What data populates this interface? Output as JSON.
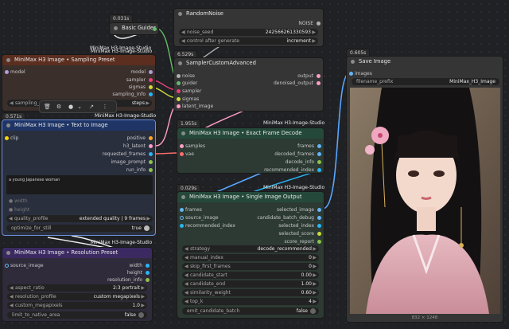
{
  "colors": {
    "image": "#64b5f6",
    "noise": "#b0b0b0",
    "guider": "#66bb6a",
    "sampler": "#ec407a",
    "sigmas": "#cddc39",
    "latent": "#ff9ec7",
    "clip": "#ffd500",
    "vae": "#ff6e6e",
    "int": "#29b6f6",
    "wire_blue": "#57a6ff",
    "wire_pink": "#f29ab8",
    "wire_white": "#f0f0f0"
  },
  "random_noise": {
    "title": "RandomNoise",
    "out": "NOISE",
    "noise_seed_label": "noise_seed",
    "noise_seed_value": "242566261330593",
    "control_label": "control after generate",
    "control_value": "increment"
  },
  "basic_guider": {
    "timing": "0.031s",
    "title": "Basic Guider",
    "tag": "MiniMax H3-Image-Studio"
  },
  "sampler_adv": {
    "timing": "6.529s",
    "title": "SamplerCustomAdvanced",
    "inputs": [
      "noise",
      "guider",
      "sampler",
      "sigmas",
      "latent_image"
    ],
    "outputs": [
      "output",
      "denoised_output"
    ]
  },
  "sampling_preset": {
    "tag": "MiniMax H3-Image-Studio",
    "title": "MiniMax H3 Image • Sampling Preset",
    "input": "model",
    "outputs": [
      "model",
      "sampler",
      "sigmas",
      "sampling_info"
    ],
    "widget_label": "sampling_p",
    "steps_label": "steps"
  },
  "text_to_image": {
    "timing": "0.571s",
    "tag": "MiniMax H3-Image-Studio",
    "title": "MiniMax H3 Image • Text to Image",
    "input": "clip",
    "outputs": [
      "positive",
      "h3_latent",
      "requested_frames",
      "image_prompt",
      "run_info"
    ],
    "prompt": "a young Japanese woman",
    "width_label": "width",
    "height_label": "height",
    "quality_label": "quality_profile",
    "quality_value": "extended quality | 9 frames",
    "optimize_label": "optimize_for_still",
    "optimize_value": "true"
  },
  "exact_frame_decode": {
    "timing": "1.955s",
    "tag": "MiniMax H3-Image-Studio",
    "title": "MiniMax H3 Image • Exact Frame Decode",
    "inputs": [
      "samples",
      "vae"
    ],
    "outputs": [
      "frames",
      "decoded_frames",
      "decode_info",
      "recommended_index"
    ]
  },
  "single_image": {
    "timing": "0.029s",
    "tag": "MiniMax H3-Image-Studio",
    "title": "MiniMax H3 Image • Single Image Output",
    "inputs": [
      "frames",
      "source_image",
      "recommended_index"
    ],
    "outputs": [
      "selected_image",
      "candidate_batch_debug",
      "selected_index",
      "selected_score",
      "score_report"
    ],
    "widgets": [
      {
        "label": "strategy",
        "value": "decode_recommended"
      },
      {
        "label": "manual_index",
        "value": "0"
      },
      {
        "label": "skip_first_frames",
        "value": "0"
      },
      {
        "label": "candidate_start",
        "value": "0.00"
      },
      {
        "label": "candidate_end",
        "value": "1.00"
      },
      {
        "label": "similarity_weight",
        "value": "0.60"
      },
      {
        "label": "top_k",
        "value": "4"
      },
      {
        "label": "emit_candidate_batch",
        "value": "false"
      }
    ]
  },
  "resolution_preset": {
    "tag": "MiniMax H3-Image-Studio",
    "title": "MiniMax H3 Image • Resolution Preset",
    "input": "source_image",
    "outputs": [
      "width",
      "height",
      "resolution_info"
    ],
    "widgets": [
      {
        "label": "aspect_ratio",
        "value": "2:3 portrait"
      },
      {
        "label": "resolution_profile",
        "value": "custom megapixels"
      },
      {
        "label": "custom_megapixels",
        "value": "1.0"
      },
      {
        "label": "limit_to_native_area",
        "value": "false"
      }
    ]
  },
  "save_image": {
    "timing": "0.605s",
    "title": "Save Image",
    "input": "images",
    "prefix_label": "filename_prefix",
    "prefix_value": "MiniMax_H3_Image",
    "dims": "832 × 1248"
  }
}
